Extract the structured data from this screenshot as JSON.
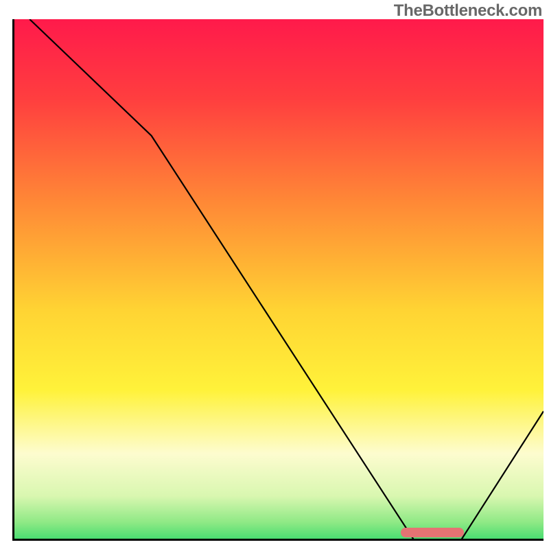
{
  "watermark": "TheBottleneck.com",
  "chart_data": {
    "type": "line",
    "title": "",
    "xlabel": "",
    "ylabel": "",
    "xlim": [
      0,
      100
    ],
    "ylim": [
      0,
      100
    ],
    "series": [
      {
        "name": "curve",
        "color": "#000000",
        "x": [
          3,
          26,
          76,
          84,
          100
        ],
        "y": [
          100,
          78,
          1,
          1,
          26
        ]
      }
    ],
    "gradient_stops": [
      {
        "offset": 0.0,
        "color": "#ff1a4b"
      },
      {
        "offset": 0.15,
        "color": "#ff3e3f"
      },
      {
        "offset": 0.35,
        "color": "#ff8a36"
      },
      {
        "offset": 0.55,
        "color": "#ffd433"
      },
      {
        "offset": 0.7,
        "color": "#fff23a"
      },
      {
        "offset": 0.82,
        "color": "#fdfccf"
      },
      {
        "offset": 0.9,
        "color": "#d9f7b0"
      },
      {
        "offset": 0.95,
        "color": "#8ee985"
      },
      {
        "offset": 1.0,
        "color": "#1fd665"
      }
    ],
    "marker": {
      "x_start": 73,
      "x_end": 85,
      "y": 1.3,
      "color": "#e57373"
    }
  }
}
